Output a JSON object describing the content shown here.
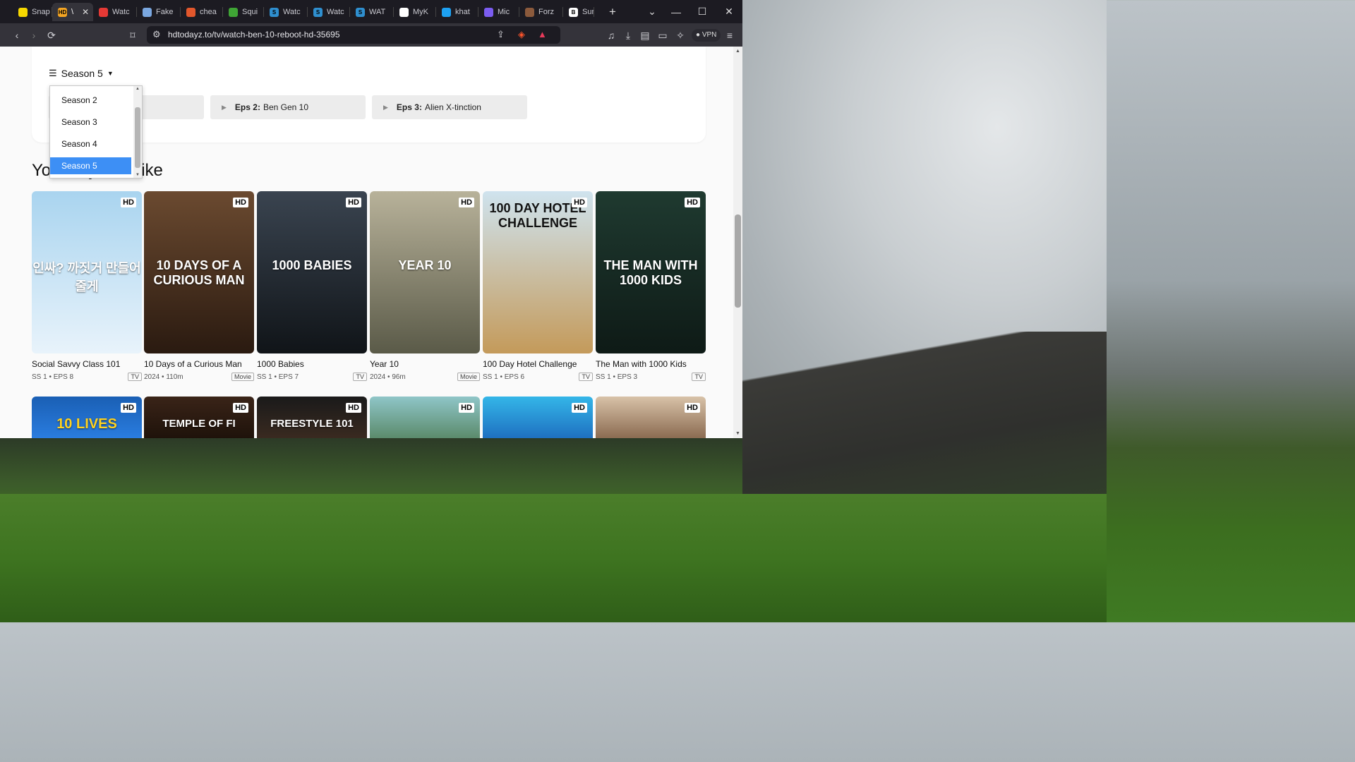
{
  "tabs": [
    {
      "label": "Snap",
      "color": "#f7d800",
      "glyph": ""
    },
    {
      "label": "\\",
      "color": "#f5a623",
      "glyph": "HD"
    },
    {
      "label": "Watc",
      "color": "#e53935",
      "glyph": ""
    },
    {
      "label": "Fake",
      "color": "#7aa7e0",
      "glyph": ""
    },
    {
      "label": "chea",
      "color": "#e2572c",
      "glyph": ""
    },
    {
      "label": "Squi",
      "color": "#3fa535",
      "glyph": ""
    },
    {
      "label": "Watc",
      "color": "#2f8fcf",
      "glyph": "S"
    },
    {
      "label": "Watc",
      "color": "#2f8fcf",
      "glyph": "S"
    },
    {
      "label": "WAT",
      "color": "#2f8fcf",
      "glyph": "S"
    },
    {
      "label": "MyK",
      "color": "#fff",
      "glyph": ""
    },
    {
      "label": "khat",
      "color": "#1da1f2",
      "glyph": ""
    },
    {
      "label": "Mic",
      "color": "#7b5cf0",
      "glyph": ""
    },
    {
      "label": "Forz",
      "color": "#8b5a3c",
      "glyph": ""
    },
    {
      "label": "Suns",
      "color": "#fff",
      "glyph": "B"
    }
  ],
  "url": "hdtodayz.to/tv/watch-ben-10-reboot-hd-35695",
  "vpn_label": "VPN",
  "season_button": "Season 5",
  "season_options": [
    "Season 2",
    "Season 3",
    "Season 4",
    "Season 5"
  ],
  "selected_season": "Season 5",
  "episodes": [
    {
      "num": "",
      "title": ""
    },
    {
      "num": "Eps 2:",
      "title": "Ben Gen 10"
    },
    {
      "num": "Eps 3:",
      "title": "Alien X-tinction"
    }
  ],
  "section_title": "You may also like",
  "hd_badge": "HD",
  "cards": [
    {
      "title": "Social Savvy Class 101",
      "meta1": "SS 1",
      "meta2": "EPS 8",
      "type": "TV",
      "poster_text": "인싸? 까짓거 만들어 줄게",
      "colors": [
        "#a9d4ef",
        "#e8f3fb"
      ]
    },
    {
      "title": "10 Days of a Curious Man",
      "meta1": "2024",
      "meta2": "110m",
      "type": "Movie",
      "poster_text": "10 DAYS OF A CURIOUS MAN",
      "colors": [
        "#6b4a30",
        "#2a1a10"
      ]
    },
    {
      "title": "1000 Babies",
      "meta1": "SS 1",
      "meta2": "EPS 7",
      "type": "TV",
      "poster_text": "1000 BABIES",
      "colors": [
        "#3a4450",
        "#101418"
      ]
    },
    {
      "title": "Year 10",
      "meta1": "2024",
      "meta2": "96m",
      "type": "Movie",
      "poster_text": "YEAR 10",
      "colors": [
        "#b8b29a",
        "#5a5a48"
      ]
    },
    {
      "title": "100 Day Hotel Challenge",
      "meta1": "SS 1",
      "meta2": "EPS 6",
      "type": "TV",
      "poster_text": "100 DAY HOTEL CHALLENGE",
      "colors": [
        "#cfe3ee",
        "#c49a5a"
      ]
    },
    {
      "title": "The Man with 1000 Kids",
      "meta1": "SS 1",
      "meta2": "EPS 3",
      "type": "TV",
      "poster_text": "THE MAN WITH 1000 KIDS",
      "colors": [
        "#1f3a30",
        "#0e1a16"
      ]
    }
  ],
  "row2": [
    {
      "poster_text": "10 LIVES",
      "colors": [
        "#1a5fb4",
        "#2a7de0"
      ]
    },
    {
      "poster_text": "TEMPLE OF FI",
      "colors": [
        "#3a2418",
        "#1e120a"
      ]
    },
    {
      "poster_text": "FREESTYLE 101",
      "colors": [
        "#1a1a1a",
        "#3a2a20"
      ]
    },
    {
      "poster_text": "",
      "colors": [
        "#8fc6c8",
        "#5a8a6a"
      ]
    },
    {
      "poster_text": "",
      "colors": [
        "#34b6e8",
        "#1e6fc0"
      ]
    },
    {
      "poster_text": "",
      "colors": [
        "#d8c2a8",
        "#8a6a50"
      ]
    }
  ]
}
